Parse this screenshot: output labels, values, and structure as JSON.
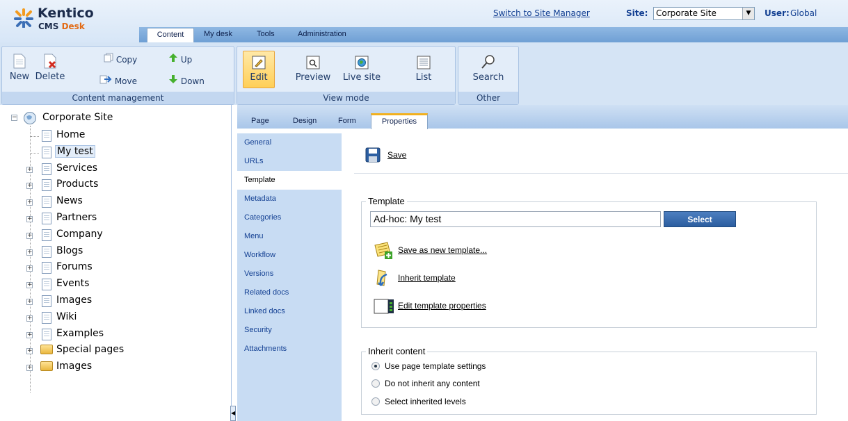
{
  "header": {
    "brand": "Kentico",
    "product_prefix": "CMS",
    "product_suffix": "Desk",
    "switch_link": "Switch to Site Manager",
    "site_label": "Site:",
    "site_value": "Corporate Site",
    "user_label": "User:",
    "user_value": "Global"
  },
  "menu": {
    "tabs": [
      "Content",
      "My desk",
      "Tools",
      "Administration"
    ]
  },
  "toolbar": {
    "content_management": {
      "caption": "Content management",
      "new": "New",
      "delete": "Delete",
      "copy": "Copy",
      "move": "Move",
      "up": "Up",
      "down": "Down"
    },
    "view_mode": {
      "caption": "View mode",
      "edit": "Edit",
      "preview": "Preview",
      "live_site": "Live site",
      "list": "List"
    },
    "other": {
      "caption": "Other",
      "search": "Search"
    }
  },
  "tree": {
    "root": "Corporate Site",
    "items": [
      {
        "label": "Home",
        "type": "doc"
      },
      {
        "label": "My test",
        "type": "doc",
        "selected": true
      },
      {
        "label": "Services",
        "type": "doc"
      },
      {
        "label": "Products",
        "type": "doc"
      },
      {
        "label": "News",
        "type": "doc"
      },
      {
        "label": "Partners",
        "type": "doc"
      },
      {
        "label": "Company",
        "type": "doc"
      },
      {
        "label": "Blogs",
        "type": "doc"
      },
      {
        "label": "Forums",
        "type": "doc"
      },
      {
        "label": "Events",
        "type": "doc"
      },
      {
        "label": "Images",
        "type": "doc"
      },
      {
        "label": "Wiki",
        "type": "doc"
      },
      {
        "label": "Examples",
        "type": "doc"
      },
      {
        "label": "Special pages",
        "type": "folder"
      },
      {
        "label": "Images",
        "type": "folder"
      }
    ]
  },
  "subtabs": [
    "Page",
    "Design",
    "Form",
    "Properties"
  ],
  "vertical_menu": {
    "items": [
      "General",
      "URLs",
      "Template",
      "Metadata",
      "Categories",
      "Menu",
      "Workflow",
      "Versions",
      "Related docs",
      "Linked docs",
      "Security",
      "Attachments"
    ],
    "active": "Template"
  },
  "properties": {
    "save_label": "Save",
    "template_legend": "Template",
    "template_value": "Ad-hoc: My test",
    "select_button": "Select",
    "save_as_new": "Save as new template...",
    "inherit_template": "Inherit template",
    "edit_template_props": "Edit template properties",
    "inherit_legend": "Inherit content",
    "radio_options": [
      "Use page template settings",
      "Do not inherit any content",
      "Select inherited levels"
    ],
    "radio_selected": "Use page template settings"
  },
  "colors": {
    "brand_orange": "#e26b16",
    "accent_blue": "#123f92",
    "active_tab_border": "#f2b01e",
    "edit_highlight": "#ffcf57"
  }
}
